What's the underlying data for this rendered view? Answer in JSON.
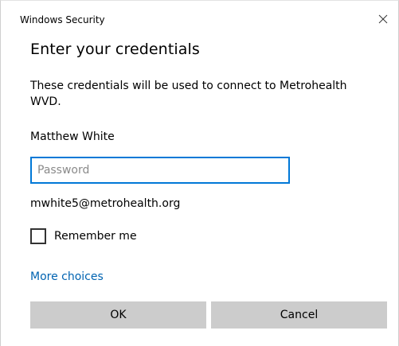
{
  "window": {
    "title": "Windows Security",
    "close_icon": "close-icon"
  },
  "dialog": {
    "heading": "Enter your credentials",
    "description": "These credentials will be used to connect to Metrohealth WVD.",
    "username": "Matthew White",
    "password": {
      "value": "",
      "placeholder": "Password"
    },
    "email": "mwhite5@metrohealth.org",
    "remember": {
      "label": "Remember me",
      "checked": false
    },
    "more_choices": "More choices",
    "ok_label": "OK",
    "cancel_label": "Cancel"
  },
  "colors": {
    "accent": "#0078d7",
    "link": "#0063b1",
    "button_bg": "#cccccc"
  }
}
